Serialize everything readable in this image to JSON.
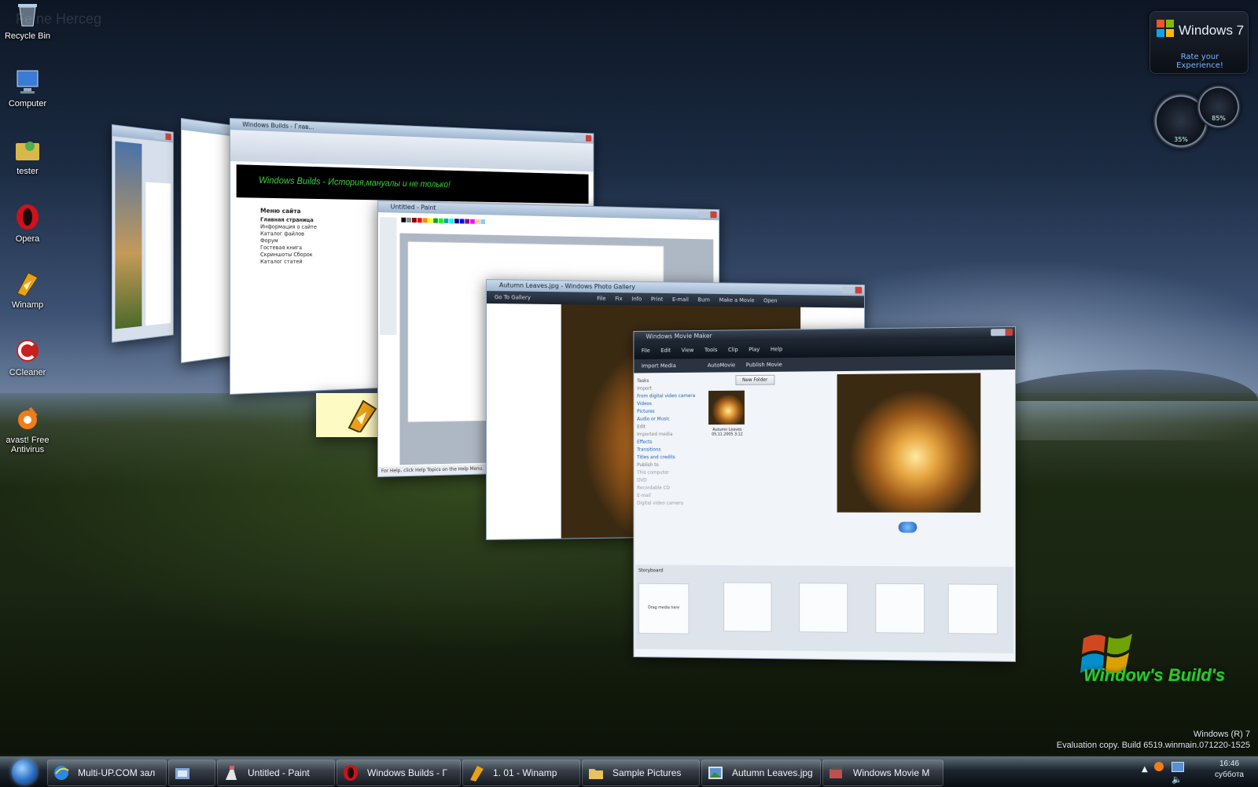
{
  "desktop": {
    "watermark_user": "Fe ne Herceg",
    "icons": [
      {
        "label": "Recycle Bin",
        "icon": "recycle-bin-icon"
      },
      {
        "label": "Computer",
        "icon": "computer-icon"
      },
      {
        "label": "tester",
        "icon": "user-folder-icon"
      },
      {
        "label": "Opera",
        "icon": "opera-icon"
      },
      {
        "label": "Winamp",
        "icon": "winamp-icon"
      },
      {
        "label": "CCleaner",
        "icon": "ccleaner-icon"
      },
      {
        "label": "avast! Free Antivirus",
        "icon": "avast-icon"
      }
    ]
  },
  "gadgets": {
    "rate_title": "Windows 7",
    "rate_link": "Rate your Experience!",
    "cpu_value": "35%",
    "mem_value": "85%"
  },
  "windows": {
    "opera_title": "Windows Builds - Глав...",
    "opera_banner": "Windows Builds - История,мануалы и не только!",
    "opera_menu_title": "Меню сайта",
    "opera_menu_items": [
      "Главная страница",
      "Информация о сайте",
      "Каталог файлов",
      "Форум",
      "Гостевая книга",
      "Скриншоты Сборок",
      "Каталог статей"
    ],
    "paint_title": "Untitled - Paint",
    "paint_status": "For Help, click Help Topics on the Help Menu.",
    "gallery_title": "Autumn Leaves.jpg - Windows Photo Gallery",
    "gallery_toolbar": [
      "Go To Gallery",
      "File",
      "Fix",
      "Info",
      "Print",
      "E-mail",
      "Burn",
      "Make a Movie",
      "Open"
    ],
    "movie_title": "Windows Movie Maker",
    "movie_menu": [
      "File",
      "Edit",
      "View",
      "Tools",
      "Clip",
      "Play",
      "Help"
    ],
    "movie_toolbar": [
      "Import Media",
      "AutoMovie",
      "Publish Movie",
      "New Folder"
    ],
    "movie_tasks": [
      "Tasks",
      "Import",
      "From digital video camera",
      "Videos",
      "Pictures",
      "Audio or Music",
      "Edit",
      "Imported media",
      "Effects",
      "Transitions",
      "Titles and credits",
      "Publish to",
      "This computer",
      "DVD",
      "Recordable CD",
      "E-mail",
      "Digital video camera"
    ],
    "movie_thumb_label": "Autumn Leaves 05.11.2005 3:12",
    "movie_storyboard": "Storyboard",
    "movie_drag": "Drag media here"
  },
  "branding": {
    "logo_text": "Window's Build's",
    "os_name": "Windows (R) 7",
    "build_text": "Evaluation copy. Build 6519.winmain.071220-1525"
  },
  "taskbar": {
    "items": [
      {
        "label": "Multi-UP.COM зал",
        "icon": "internet-explorer-icon"
      },
      {
        "label": "",
        "icon": "explorer-folder-icon"
      },
      {
        "label": "Untitled - Paint",
        "icon": "paint-icon"
      },
      {
        "label": "Windows Builds - Г",
        "icon": "opera-icon"
      },
      {
        "label": "1. 01 - Winamp",
        "icon": "winamp-icon"
      },
      {
        "label": "Sample Pictures",
        "icon": "folder-icon"
      },
      {
        "label": "Autumn Leaves.jpg",
        "icon": "photo-gallery-icon"
      },
      {
        "label": "Windows Movie M",
        "icon": "movie-maker-icon"
      }
    ],
    "clock_time": "16:46",
    "clock_day": "суббота"
  },
  "colors": {
    "accent": "#2a6fc4",
    "brand_green": "#2ec82e",
    "opera_red": "#d0111b"
  }
}
